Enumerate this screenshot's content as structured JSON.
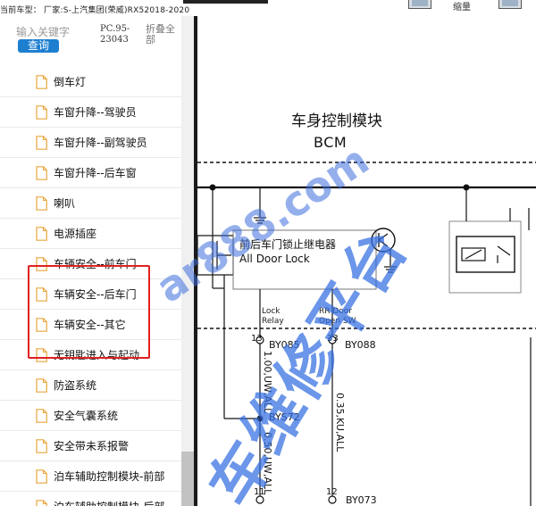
{
  "header": {
    "title": "当前车型：   厂家:S-上汽集团(荣威)RX52018-2020",
    "zoom_label": "缩量"
  },
  "search": {
    "placeholder": "输入关键字",
    "button_label": "查询",
    "doc_code": "PC.95-23043",
    "fold_all_label": "折叠全部"
  },
  "tree": {
    "items": [
      {
        "label": "倒车灯"
      },
      {
        "label": "车窗升降--驾驶员"
      },
      {
        "label": "车窗升降--副驾驶员"
      },
      {
        "label": "车窗升降--后车窗"
      },
      {
        "label": "喇叭"
      },
      {
        "label": "电源插座"
      },
      {
        "label": "车辆安全--前车门"
      },
      {
        "label": "车辆安全--后车门"
      },
      {
        "label": "车辆安全--其它"
      },
      {
        "label": "无钥匙进入与起动"
      },
      {
        "label": "防盗系统"
      },
      {
        "label": "安全气囊系统"
      },
      {
        "label": "安全带未系报警"
      },
      {
        "label": "泊车辅助控制模块-前部"
      },
      {
        "label": "泊车辅助控制模块-后部"
      }
    ],
    "highlight_color": "#e02020"
  },
  "diagram": {
    "module_title": "车身控制模块",
    "module_code": "BCM",
    "relay_cn": "前后车门锁止继电器",
    "relay_en": "All Door Lock",
    "lock_relay_line1": "Lock",
    "lock_relay_line2": "Relay",
    "rr_door_line1": "RR Door",
    "rr_door_line2": "Open SW",
    "pin_13": "13",
    "conn_by085": "BY085",
    "pin_33": "33",
    "conn_by088": "BY088",
    "wire_1": "1.00,UW,ALL",
    "wire_2": "0.35,KU,ALL",
    "wire_3": "0.50,UW,ALL",
    "splice": "BYS72",
    "pin_11": "11",
    "pin_12": "12",
    "conn_by073": "BY073",
    "accent_color": "#1e7fd1"
  },
  "watermark": {
    "url_text": "ar888.com",
    "cn_text": "车维修平台"
  }
}
